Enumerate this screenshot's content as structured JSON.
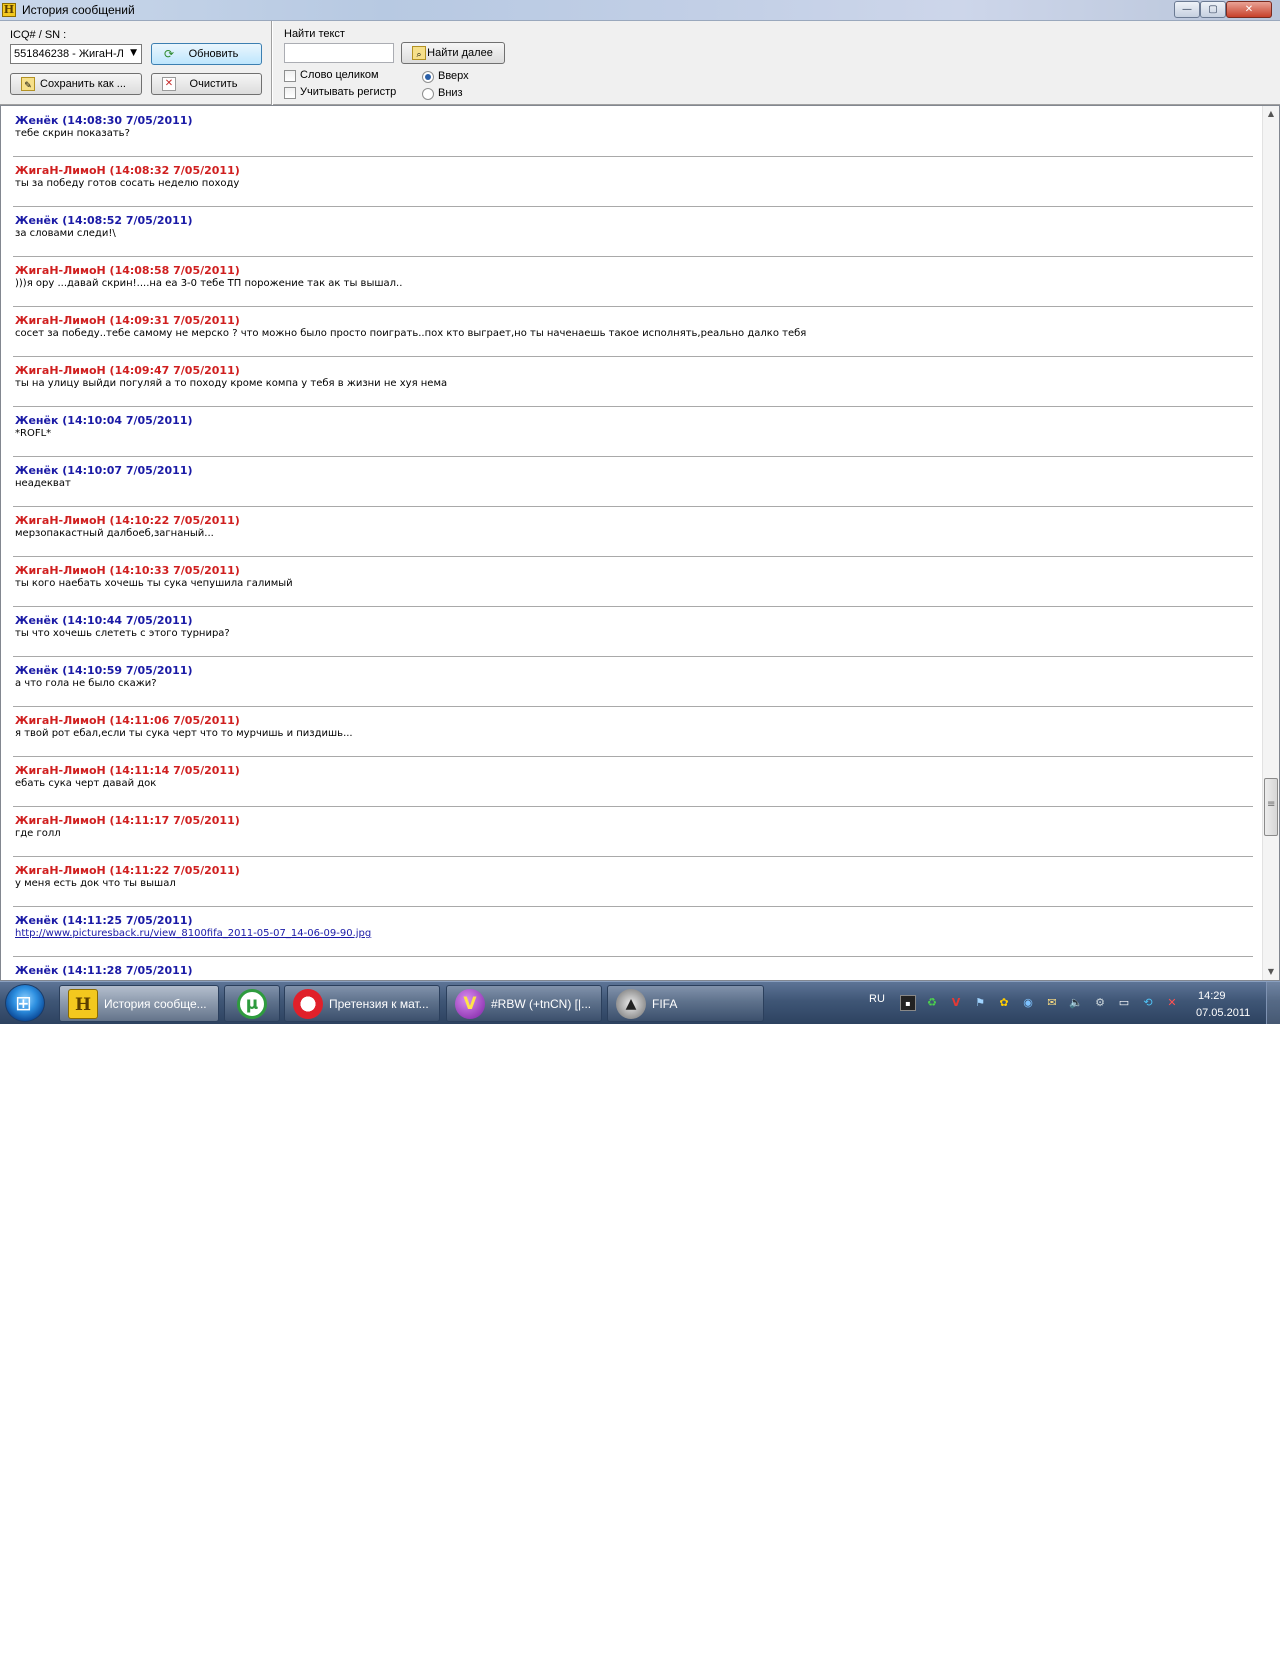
{
  "window": {
    "title": "История сообщений",
    "icon_letter": "H",
    "minimize": "—",
    "maximize": "▢",
    "close": "✕"
  },
  "toolbar": {
    "icq_label": "ICQ# / SN :",
    "icq_selected": "551846238 - ЖигаН-Л",
    "refresh_label": "Обновить",
    "save_label": "Сохранить как ...",
    "clear_label": "Очистить",
    "find_label": "Найти текст",
    "find_value": "",
    "find_next_label": "Найти далее",
    "whole_word_label": "Слово целиком",
    "match_case_label": "Учитывать регистр",
    "dir_up_label": "Вверх",
    "dir_down_label": "Вниз",
    "direction_selected": "Вверх"
  },
  "messages": [
    {
      "sender": "Женёк",
      "color": "blue",
      "header": "Женёк (14:08:30 7/05/2011)",
      "text": "тебе скрин показать?"
    },
    {
      "sender": "ЖигаН-ЛимоН",
      "color": "red",
      "header": "ЖигаН-ЛимоН (14:08:32 7/05/2011)",
      "text": "ты за победу готов сосать неделю походу"
    },
    {
      "sender": "Женёк",
      "color": "blue",
      "header": "Женёк (14:08:52 7/05/2011)",
      "text": "за словами следи!\\"
    },
    {
      "sender": "ЖигаН-ЛимоН",
      "color": "red",
      "header": "ЖигаН-ЛимоН (14:08:58 7/05/2011)",
      "text": ")))я ору ...давай скрин!....на еа 3-0 тебе ТП порожение так ак ты вышал.."
    },
    {
      "sender": "ЖигаН-ЛимоН",
      "color": "red",
      "header": "ЖигаН-ЛимоН (14:09:31 7/05/2011)",
      "text": "сосет за победу..тебе самому не мерско ? что можно было просто поиграть..пох кто выграет,но ты наченаешь такое исполнять,реально далко тебя"
    },
    {
      "sender": "ЖигаН-ЛимоН",
      "color": "red",
      "header": "ЖигаН-ЛимоН (14:09:47 7/05/2011)",
      "text": "ты на улицу выйди погуляй а то походу кроме компа у тебя в жизни не хуя нема"
    },
    {
      "sender": "Женёк",
      "color": "blue",
      "header": "Женёк (14:10:04 7/05/2011)",
      "text": "*ROFL*"
    },
    {
      "sender": "Женёк",
      "color": "blue",
      "header": "Женёк (14:10:07 7/05/2011)",
      "text": "неадекват"
    },
    {
      "sender": "ЖигаН-ЛимоН",
      "color": "red",
      "header": "ЖигаН-ЛимоН (14:10:22 7/05/2011)",
      "text": "мерзопакастный далбоеб,загнаный..."
    },
    {
      "sender": "ЖигаН-ЛимоН",
      "color": "red",
      "header": "ЖигаН-ЛимоН (14:10:33 7/05/2011)",
      "text": "ты кого наебать хочешь ты сука чепушила галимый"
    },
    {
      "sender": "Женёк",
      "color": "blue",
      "header": "Женёк (14:10:44 7/05/2011)",
      "text": "ты что хочешь слететь с этого турнира?"
    },
    {
      "sender": "Женёк",
      "color": "blue",
      "header": "Женёк (14:10:59 7/05/2011)",
      "text": "а что гола не было скажи?"
    },
    {
      "sender": "ЖигаН-ЛимоН",
      "color": "red",
      "header": "ЖигаН-ЛимоН (14:11:06 7/05/2011)",
      "text": "я твой рот ебал,если ты сука черт что то мурчишь и пиздишь..."
    },
    {
      "sender": "ЖигаН-ЛимоН",
      "color": "red",
      "header": "ЖигаН-ЛимоН (14:11:14 7/05/2011)",
      "text": "ебать сука черт давай док"
    },
    {
      "sender": "ЖигаН-ЛимоН",
      "color": "red",
      "header": "ЖигаН-ЛимоН (14:11:17 7/05/2011)",
      "text": "где голл"
    },
    {
      "sender": "ЖигаН-ЛимоН",
      "color": "red",
      "header": "ЖигаН-ЛимоН (14:11:22 7/05/2011)",
      "text": "у меня есть док что ты вышал"
    },
    {
      "sender": "Женёк",
      "color": "blue",
      "header": "Женёк (14:11:25 7/05/2011)",
      "text": "http://www.picturesback.ru/view_8100fifa_2011-05-07_14-06-09-90.jpg",
      "is_link": true
    },
    {
      "sender": "Женёк",
      "color": "blue",
      "header": "Женёк (14:11:28 7/05/2011)",
      "text": ""
    }
  ],
  "taskbar": {
    "items": [
      {
        "label": "История сообще...",
        "icon": "H",
        "active": true
      },
      {
        "label": "",
        "icon": "utorrent-icon"
      },
      {
        "label": "Претензия к мат...",
        "icon": "opera-icon"
      },
      {
        "label": "#RBW (+tnCN) [|...",
        "icon": "V"
      },
      {
        "label": "FIFA",
        "icon": "fifa-icon"
      }
    ],
    "language": "RU",
    "clock_time": "14:29",
    "clock_date": "07.05.2011"
  },
  "colors": {
    "sender_blue": "#1a1aa6",
    "sender_red": "#d01f1f"
  }
}
